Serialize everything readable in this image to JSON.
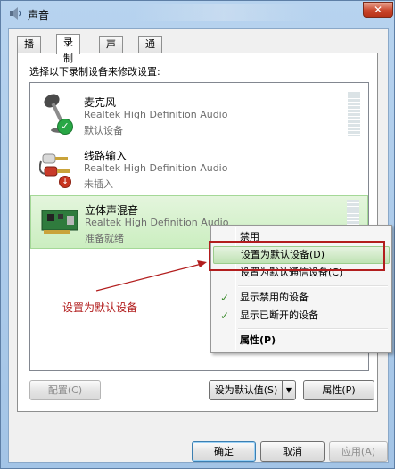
{
  "window": {
    "title": "声音",
    "icon": "speaker-icon",
    "close_symbol": "✕"
  },
  "tabs": [
    {
      "label": "播放",
      "active": false
    },
    {
      "label": "录制",
      "active": true
    },
    {
      "label": "声音",
      "active": false
    },
    {
      "label": "通信",
      "active": false
    }
  ],
  "instruction": "选择以下录制设备来修改设置:",
  "devices": [
    {
      "name": "麦克风",
      "driver": "Realtek High Definition Audio",
      "status": "默认设备",
      "icon": "microphone-icon",
      "badge": "green-check",
      "selected": false
    },
    {
      "name": "线路输入",
      "driver": "Realtek High Definition Audio",
      "status": "未插入",
      "icon": "line-in-jack-icon",
      "badge": "red-down-arrow",
      "selected": false
    },
    {
      "name": "立体声混音",
      "driver": "Realtek High Definition Audio",
      "status": "准备就绪",
      "icon": "sound-card-icon",
      "badge": "",
      "selected": true
    }
  ],
  "context_menu": {
    "items": [
      {
        "label": "禁用",
        "checked": false,
        "highlighted": false,
        "bold": false
      },
      {
        "label": "设置为默认设备(D)",
        "checked": false,
        "highlighted": true,
        "bold": false
      },
      {
        "label": "设置为默认通信设备(C)",
        "checked": false,
        "highlighted": false,
        "bold": false
      },
      {
        "label": "显示禁用的设备",
        "checked": true,
        "highlighted": false,
        "bold": false
      },
      {
        "label": "显示已断开的设备",
        "checked": true,
        "highlighted": false,
        "bold": false
      },
      {
        "label": "属性(P)",
        "checked": false,
        "highlighted": false,
        "bold": true
      }
    ]
  },
  "annotation": {
    "label": "设置为默认设备",
    "color": "#b21d1d"
  },
  "panel_buttons": {
    "configure": "配置(C)",
    "set_default": "设为默认值(S)",
    "properties": "属性(P)"
  },
  "dialog_buttons": {
    "ok": "确定",
    "cancel": "取消",
    "apply": "应用(A)"
  },
  "colors": {
    "selection_green": "#cbeec0",
    "annotation_red": "#b21d1d",
    "title_bar": "#b7d3ef"
  }
}
